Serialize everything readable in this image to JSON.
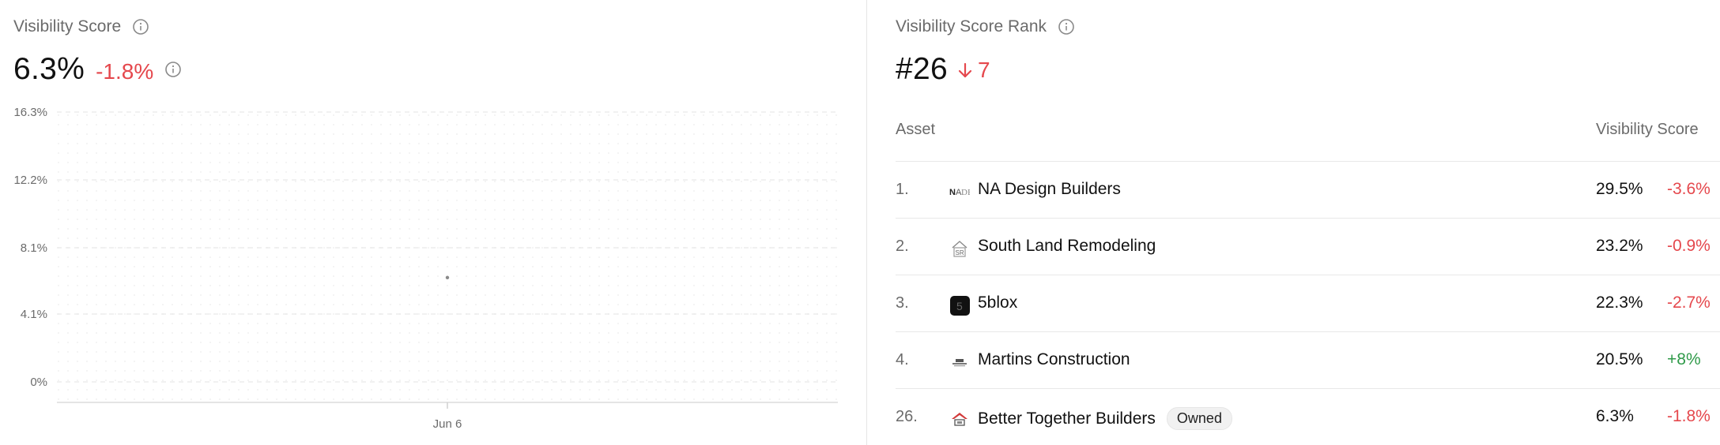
{
  "visibility": {
    "title": "Visibility Score",
    "value": "6.3%",
    "change": "-1.8%"
  },
  "chart_data": {
    "type": "scatter",
    "y_ticks": [
      "16.3%",
      "12.2%",
      "8.1%",
      "4.1%",
      "0%"
    ],
    "ylim": [
      0,
      16.3
    ],
    "x_ticks": [
      "Jun 6"
    ],
    "points": [
      {
        "x": "Jun 6",
        "y": 6.3
      }
    ],
    "grid": true
  },
  "rank": {
    "title": "Visibility Score Rank",
    "value": "#26",
    "change": "7"
  },
  "table": {
    "col_asset": "Asset",
    "col_score": "Visibility Score",
    "rows": [
      {
        "rank": "1.",
        "name": "NA Design Builders",
        "score": "29.5%",
        "change": "-3.6%",
        "trend": "neg",
        "logo": "nadb-logo",
        "owned": ""
      },
      {
        "rank": "2.",
        "name": "South Land Remodeling",
        "score": "23.2%",
        "change": "-0.9%",
        "trend": "neg",
        "logo": "house-sr-logo",
        "owned": ""
      },
      {
        "rank": "3.",
        "name": "5blox",
        "score": "22.3%",
        "change": "-2.7%",
        "trend": "neg",
        "logo": "5blox-logo",
        "owned": ""
      },
      {
        "rank": "4.",
        "name": "Martins Construction",
        "score": "20.5%",
        "change": "+8%",
        "trend": "pos",
        "logo": "martins-logo",
        "owned": ""
      },
      {
        "rank": "26.",
        "name": "Better Together Builders",
        "score": "6.3%",
        "change": "-1.8%",
        "trend": "neg",
        "logo": "roof-logo",
        "owned": "Owned"
      }
    ]
  }
}
